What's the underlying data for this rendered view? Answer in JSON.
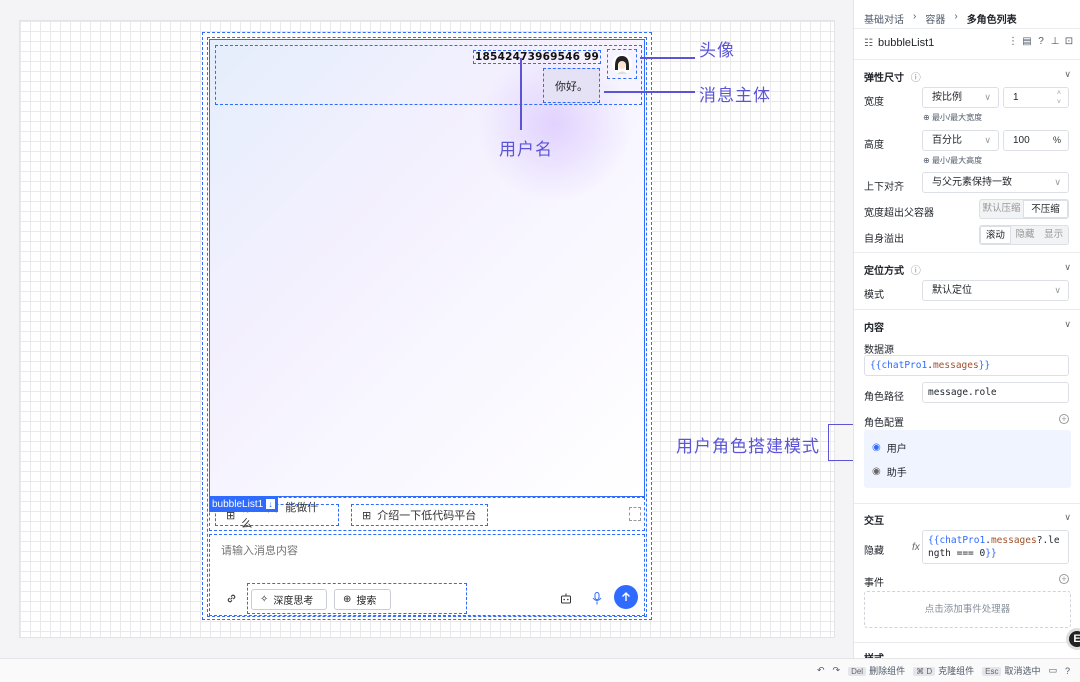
{
  "canvas": {
    "username": "18542473969546 99",
    "message": "你好。",
    "selection_tag": "bubbleList1",
    "prompts": [
      "你是谁，能做什么",
      "介绍一下低代码平台"
    ],
    "input_placeholder": "请输入消息内容",
    "tools": [
      "深度思考",
      "搜索"
    ]
  },
  "annotations": {
    "avatar": "头像",
    "message_body": "消息主体",
    "username": "用户名",
    "role_mode": "用户角色搭建模式"
  },
  "panel": {
    "breadcrumb": [
      "基础对话",
      "容器",
      "多角色列表"
    ],
    "component_name": "bubbleList1",
    "flex_section": "弹性尺寸",
    "width_label": "宽度",
    "width_mode": "按比例",
    "width_value": "1",
    "width_hint": "最小/最大宽度",
    "height_label": "高度",
    "height_mode": "百分比",
    "height_value": "100",
    "height_unit": "%",
    "height_hint": "最小/最大高度",
    "valign_label": "上下对齐",
    "valign_value": "与父元素保持一致",
    "overflow_parent_label": "宽度超出父容器",
    "overflow_parent_options": [
      "默认压缩",
      "不压缩"
    ],
    "self_overflow_label": "自身溢出",
    "self_overflow_options": [
      "滚动",
      "隐藏",
      "显示"
    ],
    "position_section": "定位方式",
    "mode_label": "模式",
    "mode_value": "默认定位",
    "content_section": "内容",
    "datasource_label": "数据源",
    "datasource_open": "{{",
    "datasource_obj": "chatPro1",
    "datasource_dot": ".",
    "datasource_prop": "messages",
    "datasource_close": "}}",
    "role_path_label": "角色路径",
    "role_path_value": "message.role",
    "role_config_label": "角色配置",
    "roles": [
      "用户",
      "助手"
    ],
    "interaction_section": "交互",
    "hidden_label": "隐藏",
    "fx": "fx",
    "hidden_line1_open": "{{",
    "hidden_line1_obj": "chatPro1",
    "hidden_line1_dot": ".",
    "hidden_line1_prop": "messages",
    "hidden_line1_rest": "?.le",
    "hidden_line2_prop": "ngth",
    "hidden_line2_rest": " === 0",
    "hidden_line2_close": "}}",
    "events_label": "事件",
    "add_event": "点击添加事件处理器",
    "style_section": "样式"
  },
  "footer": {
    "delete_key": "Del",
    "delete_label": "删除组件",
    "clone_key": "⌘ D",
    "clone_label": "克隆组件",
    "esc_key": "Esc",
    "esc_label": "取消选中"
  },
  "fab_label": "E",
  "colors": {
    "accent": "#2f6bff",
    "annotation": "#5b55d6"
  }
}
